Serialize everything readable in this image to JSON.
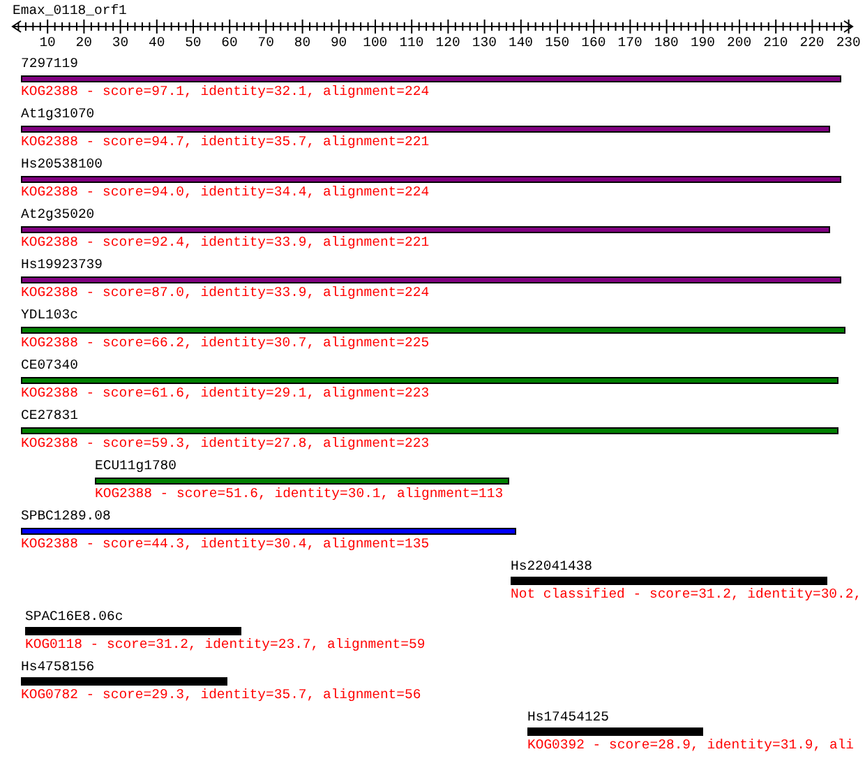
{
  "query": {
    "title": "Emax_0118_orf1",
    "ticks": [
      "10",
      "20",
      "30",
      "40",
      "50",
      "60",
      "70",
      "80",
      "90",
      "100",
      "110",
      "120",
      "130",
      "140",
      "150",
      "160",
      "170",
      "180",
      "190",
      "200",
      "210",
      "220",
      "230"
    ]
  },
  "hits": [
    {
      "name": "7297119",
      "kind": "outlined",
      "color": "#800080",
      "description": "KOG2388 - score=97.1, identity=32.1, alignment=224"
    },
    {
      "name": "At1g31070",
      "kind": "outlined",
      "color": "#800080",
      "description": "KOG2388 - score=94.7, identity=35.7, alignment=221"
    },
    {
      "name": "Hs20538100",
      "kind": "outlined",
      "color": "#800080",
      "description": "KOG2388 - score=94.0, identity=34.4, alignment=224"
    },
    {
      "name": "At2g35020",
      "kind": "outlined",
      "color": "#800080",
      "description": "KOG2388 - score=92.4, identity=33.9, alignment=221"
    },
    {
      "name": "Hs19923739",
      "kind": "outlined",
      "color": "#800080",
      "description": "KOG2388 - score=87.0, identity=33.9, alignment=224"
    },
    {
      "name": "YDL103c",
      "kind": "outlined",
      "color": "#008000",
      "description": "KOG2388 - score=66.2, identity=30.7, alignment=225"
    },
    {
      "name": "CE07340",
      "kind": "outlined",
      "color": "#008000",
      "description": "KOG2388 - score=61.6, identity=29.1, alignment=223"
    },
    {
      "name": "CE27831",
      "kind": "outlined",
      "color": "#008000",
      "description": "KOG2388 - score=59.3, identity=27.8, alignment=223"
    },
    {
      "name": "ECU11g1780",
      "kind": "outlined",
      "color": "#008000",
      "description": "KOG2388 - score=51.6, identity=30.1, alignment=113"
    },
    {
      "name": "SPBC1289.08",
      "kind": "outlined",
      "color": "#0000ff",
      "description": "KOG2388 - score=44.3, identity=30.4, alignment=135"
    },
    {
      "name": "Hs22041438",
      "kind": "solid",
      "color": "#000000",
      "description": "Not classified - score=31.2, identity=30.2,"
    },
    {
      "name": "SPAC16E8.06c",
      "kind": "solid",
      "color": "#000000",
      "description": "KOG0118 - score=31.2, identity=23.7, alignment=59"
    },
    {
      "name": "Hs4758156",
      "kind": "solid",
      "color": "#000000",
      "description": "KOG0782 - score=29.3, identity=35.7, alignment=56"
    },
    {
      "name": "Hs17454125",
      "kind": "solid",
      "color": "#000000",
      "description": "KOG0392 - score=28.9, identity=31.9, ali"
    }
  ]
}
